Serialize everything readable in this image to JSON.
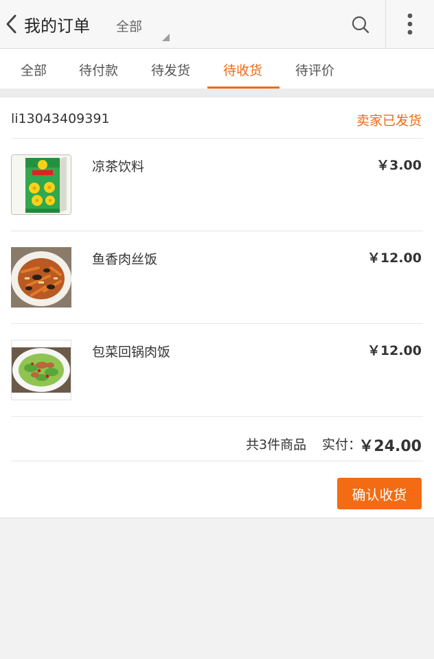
{
  "header": {
    "title": "我的订单",
    "filter_label": "全部",
    "back_icon": "chevron-left-icon",
    "search_icon": "search-icon",
    "more_icon": "more-vertical-icon"
  },
  "tabs": [
    {
      "label": "全部",
      "active": false
    },
    {
      "label": "待付款",
      "active": false
    },
    {
      "label": "待发货",
      "active": false
    },
    {
      "label": "待收货",
      "active": true
    },
    {
      "label": "待评价",
      "active": false
    }
  ],
  "order": {
    "seller": "li13043409391",
    "status": "卖家已发货",
    "items": [
      {
        "name": "凉茶饮料",
        "price": "￥3.00"
      },
      {
        "name": "鱼香肉丝饭",
        "price": "￥12.00"
      },
      {
        "name": "包菜回锅肉饭",
        "price": "￥12.00"
      }
    ],
    "summary": {
      "count_text": "共3件商品",
      "paid_label": "实付：",
      "total": "￥24.00"
    },
    "confirm_button": "确认收货"
  },
  "colors": {
    "accent": "#ef6a12",
    "button_bg": "#f36b13",
    "page_bg": "#f2f2f2"
  }
}
